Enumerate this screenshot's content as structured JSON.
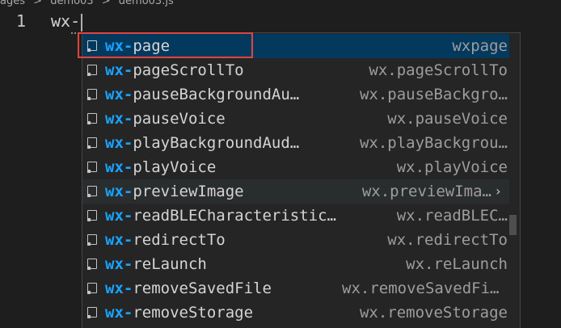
{
  "breadcrumb": [
    "ages",
    ">",
    "demo03",
    ">",
    "demo03.js"
  ],
  "editor": {
    "line_number": "1",
    "typed_text": "wx-"
  },
  "suggestions": {
    "prefix": "wx-",
    "items": [
      {
        "name": "page",
        "detail": "wxpage",
        "state": "selected"
      },
      {
        "name": "pageScrollTo",
        "detail": "wx.pageScrollTo"
      },
      {
        "name": "pauseBackgroundAu…",
        "detail": "wx.pauseBackgro…"
      },
      {
        "name": "pauseVoice",
        "detail": "wx.pauseVoice"
      },
      {
        "name": "playBackgroundAud…",
        "detail": "wx.playBackgrou…"
      },
      {
        "name": "playVoice",
        "detail": "wx.playVoice"
      },
      {
        "name": "previewImage",
        "detail": "wx.previewIma…",
        "state": "hover",
        "more": "›"
      },
      {
        "name": "readBLECharacteristic…",
        "detail": "wx.readBLEC…"
      },
      {
        "name": "redirectTo",
        "detail": "wx.redirectTo"
      },
      {
        "name": "reLaunch",
        "detail": "wx.reLaunch"
      },
      {
        "name": "removeSavedFile",
        "detail": "wx.removeSavedFile"
      },
      {
        "name": "removeStorage",
        "detail": "wx.removeStorage"
      }
    ],
    "icon": "snippet-icon"
  },
  "colors": {
    "background": "#1e1e1e",
    "widget_bg": "#252526",
    "selected_bg": "#04395e",
    "match_highlight": "#18a3ff",
    "focus_outline": "#e0443e"
  }
}
